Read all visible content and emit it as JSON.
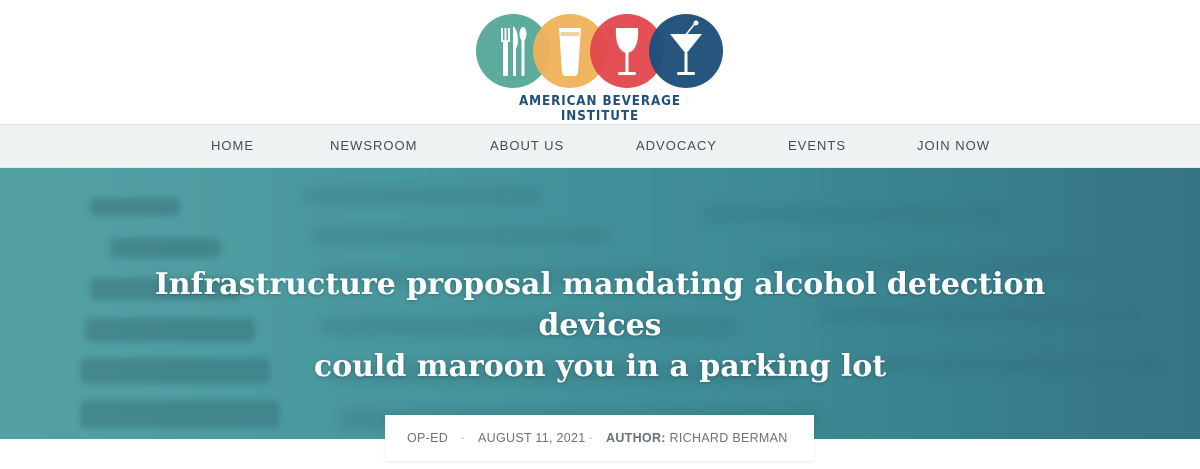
{
  "brand": {
    "name": "AMERICAN BEVERAGE INSTITUTE",
    "colors": {
      "teal": "#57a89a",
      "orange": "#f0b15a",
      "red": "#e0474c",
      "navy": "#1f4f7a"
    },
    "icons": [
      "fork-knife-spoon-icon",
      "beer-glass-icon",
      "wine-glass-icon",
      "martini-glass-icon"
    ]
  },
  "nav": {
    "items": [
      {
        "label": "HOME"
      },
      {
        "label": "NEWSROOM"
      },
      {
        "label": "ABOUT US"
      },
      {
        "label": "ADVOCACY"
      },
      {
        "label": "EVENTS"
      },
      {
        "label": "JOIN NOW"
      }
    ]
  },
  "article": {
    "title_line1": "Infrastructure proposal mandating alcohol detection devices",
    "title_line2": "could maroon you in a parking lot",
    "category": "OP-ED",
    "date": "AUGUST 11, 2021",
    "author_label": "AUTHOR:",
    "author_name": "RICHARD BERMAN",
    "separator": "·"
  }
}
